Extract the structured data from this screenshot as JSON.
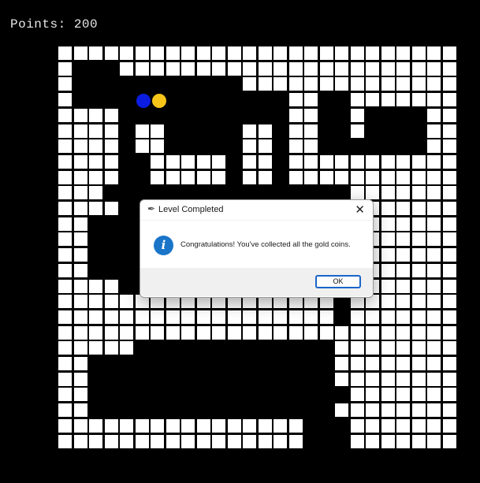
{
  "score": {
    "text": "Points: 200"
  },
  "maze": {
    "rows": [
      "11111111111111111111111111",
      "10001111111111111111111111",
      "10000000000011111111111111",
      "10000000000000011001111111",
      "11110000000000011001000011",
      "11110110000011011001000011",
      "11110110000011011000000011",
      "11110011111011011111111111",
      "11110011111011011111111111",
      "11100000000000000001111111",
      "11110000000000000001111111",
      "11000000000000000001111111",
      "11000000000000000001111111",
      "11000000000000000001111111",
      "11000000000000000001111111",
      "11110000000000000001111111",
      "11111111111111111101111111",
      "11111111111111111101111111",
      "11111111111111111111111111",
      "11111000000000000011111111",
      "11000000000000000011111111",
      "11000000000000000011111111",
      "11000000000000000001111111",
      "11000000000000000011111111",
      "11111111111111110001111111",
      "11111111111111110001111111"
    ],
    "player_color": "#0b1de0",
    "coin_color": "#f7c51a"
  },
  "dialog": {
    "title": "Level Completed",
    "close": "✕",
    "icon": "info-icon",
    "message": "Congratulations! You've collected all the gold coins.",
    "ok_label": "OK"
  }
}
